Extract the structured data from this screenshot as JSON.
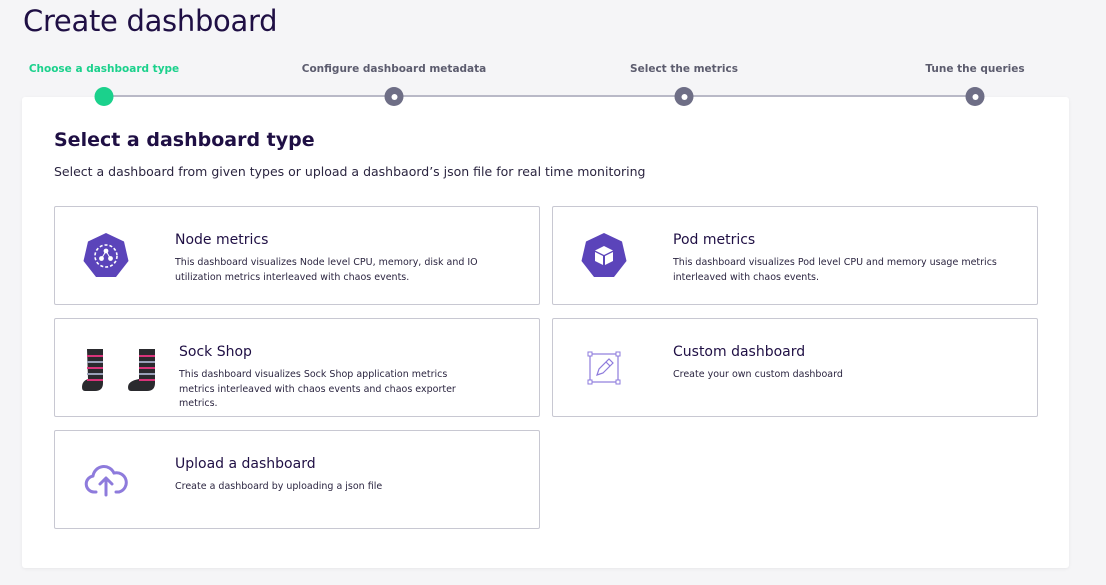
{
  "page": {
    "title": "Create dashboard"
  },
  "stepper": {
    "steps": [
      {
        "label": "Choose a dashboard type",
        "state": "active"
      },
      {
        "label": "Configure dashboard metadata",
        "state": "pending"
      },
      {
        "label": "Select the metrics",
        "state": "pending"
      },
      {
        "label": "Tune the queries",
        "state": "pending"
      }
    ],
    "colors": {
      "active": "#1bd18c",
      "pending": "#6e6e86"
    }
  },
  "content": {
    "heading": "Select a dashboard type",
    "subheading": "Select a dashboard from given types or upload a dashbaord’s json file for real time monitoring",
    "cards": [
      {
        "title": "Node metrics",
        "description": "This dashboard visualizes Node level CPU, memory, disk and IO utilization metrics interleaved with chaos events.",
        "icon": "kubernetes-node-icon"
      },
      {
        "title": "Pod metrics",
        "description": "This dashboard visualizes Pod level CPU and memory usage metrics interleaved with chaos events.",
        "icon": "kubernetes-pod-icon"
      },
      {
        "title": "Sock Shop",
        "description": "This dashboard visualizes Sock Shop application metrics metrics interleaved with chaos events and chaos exporter metrics.",
        "icon": "socks-image"
      },
      {
        "title": "Custom dashboard",
        "description": "Create your own custom dashboard",
        "icon": "edit-canvas-icon"
      },
      {
        "title": "Upload a dashboard",
        "description": "Create a dashboard by uploading a json file",
        "icon": "cloud-upload-icon"
      }
    ],
    "colors": {
      "icon_purple": "#5b44ba",
      "icon_light": "#8e7bdc"
    }
  }
}
